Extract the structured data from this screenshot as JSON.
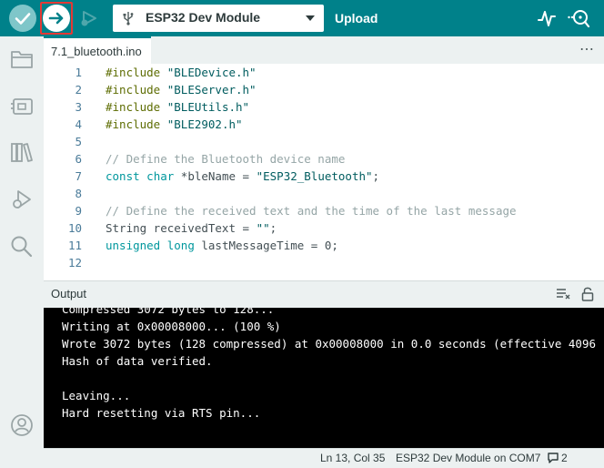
{
  "toolbar": {
    "board": "ESP32 Dev Module",
    "upload_label": "Upload",
    "icons": [
      "verify-icon",
      "upload-icon",
      "debug-icon",
      "usb-icon",
      "chevron-down-icon",
      "serial-plotter-icon",
      "serial-monitor-icon"
    ]
  },
  "sidebar": {
    "items": [
      "folder-icon",
      "board-manager-icon",
      "library-icon",
      "debug-icon",
      "search-icon",
      "account-icon"
    ]
  },
  "tabs": [
    {
      "label": "7.1_bluetooth.ino",
      "active": true
    }
  ],
  "tab_more": "⋯",
  "editor": {
    "lines": [
      {
        "n": "1",
        "tokens": [
          [
            "inc",
            "#include"
          ],
          [
            "plain",
            " "
          ],
          [
            "str",
            "\"BLEDevice.h\""
          ]
        ]
      },
      {
        "n": "2",
        "tokens": [
          [
            "inc",
            "#include"
          ],
          [
            "plain",
            " "
          ],
          [
            "str",
            "\"BLEServer.h\""
          ]
        ]
      },
      {
        "n": "3",
        "tokens": [
          [
            "inc",
            "#include"
          ],
          [
            "plain",
            " "
          ],
          [
            "str",
            "\"BLEUtils.h\""
          ]
        ]
      },
      {
        "n": "4",
        "tokens": [
          [
            "inc",
            "#include"
          ],
          [
            "plain",
            " "
          ],
          [
            "str",
            "\"BLE2902.h\""
          ]
        ]
      },
      {
        "n": "5",
        "tokens": []
      },
      {
        "n": "6",
        "tokens": [
          [
            "cmt",
            "// Define the Bluetooth device name"
          ]
        ]
      },
      {
        "n": "7",
        "tokens": [
          [
            "kw",
            "const"
          ],
          [
            "plain",
            " "
          ],
          [
            "kw",
            "char"
          ],
          [
            "plain",
            " *bleName = "
          ],
          [
            "str",
            "\"ESP32_Bluetooth\""
          ],
          [
            "plain",
            ";"
          ]
        ]
      },
      {
        "n": "8",
        "tokens": []
      },
      {
        "n": "9",
        "tokens": [
          [
            "cmt",
            "// Define the received text and the time of the last message"
          ]
        ]
      },
      {
        "n": "10",
        "tokens": [
          [
            "plain",
            "String receivedText = "
          ],
          [
            "str",
            "\"\""
          ],
          [
            "plain",
            ";"
          ]
        ]
      },
      {
        "n": "11",
        "tokens": [
          [
            "kw",
            "unsigned"
          ],
          [
            "plain",
            " "
          ],
          [
            "kw",
            "long"
          ],
          [
            "plain",
            " lastMessageTime = 0;"
          ]
        ]
      },
      {
        "n": "12",
        "tokens": []
      }
    ]
  },
  "output": {
    "label": "Output",
    "lines": [
      "Compressed 3072 bytes to 128...",
      "Writing at 0x00008000... (100 %)",
      "Wrote 3072 bytes (128 compressed) at 0x00008000 in 0.0 seconds (effective 4096",
      "Hash of data verified.",
      "",
      "Leaving...",
      "Hard resetting via RTS pin..."
    ]
  },
  "status": {
    "cursor": "Ln 13, Col 35",
    "board_port": "ESP32 Dev Module on COM7",
    "notifications": "2"
  },
  "colors": {
    "toolbar": "#00818a",
    "sidebar": "#ecf1f1",
    "console": "#000000",
    "highlight": "#e53935"
  }
}
